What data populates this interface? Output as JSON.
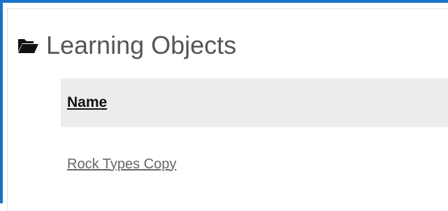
{
  "section": {
    "title": "Learning Objects",
    "icon": "folder-open-icon"
  },
  "table": {
    "columns": [
      "Name"
    ],
    "rows": [
      {
        "name": "Rock Types Copy"
      }
    ]
  },
  "colors": {
    "accent_border": "#1a73c7",
    "header_bg": "#ececec",
    "heading_text": "#555555",
    "link_text": "#666666"
  }
}
